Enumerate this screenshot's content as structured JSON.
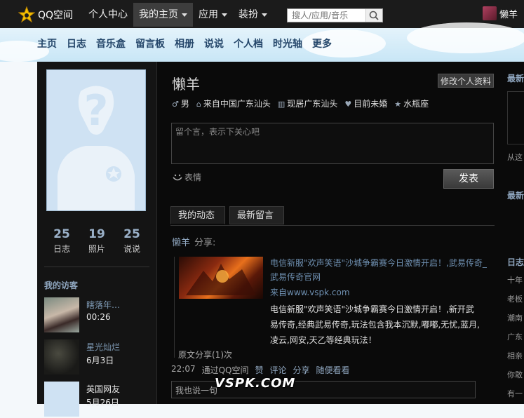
{
  "topbar": {
    "logo": "QQ空间",
    "nav": [
      {
        "label": "个人中心",
        "dropdown": false
      },
      {
        "label": "我的主页",
        "dropdown": true
      },
      {
        "label": "应用",
        "dropdown": true
      },
      {
        "label": "装扮",
        "dropdown": true
      }
    ],
    "search_placeholder": "搜人/应用/音乐",
    "username": "懒羊"
  },
  "subnav": [
    "主页",
    "日志",
    "音乐盒",
    "留言板",
    "相册",
    "说说",
    "个人档",
    "时光轴",
    "更多"
  ],
  "profile": {
    "stats": [
      {
        "value": "25",
        "label": "日志"
      },
      {
        "value": "19",
        "label": "照片"
      },
      {
        "value": "25",
        "label": "说说"
      }
    ],
    "visitors_title": "我的访客",
    "visitors": [
      {
        "name": "瞎落年…",
        "time": "00:26"
      },
      {
        "name": "星光灿烂",
        "time": "6月3日"
      },
      {
        "name": "英国网友",
        "time": "5月26日"
      }
    ]
  },
  "main": {
    "name": "懒羊",
    "edit_label": "修改个人资料",
    "info": [
      {
        "icon": "gender-icon",
        "text": "男"
      },
      {
        "icon": "home-icon",
        "text": "来自中国广东汕头"
      },
      {
        "icon": "city-icon",
        "text": "现居广东汕头"
      },
      {
        "icon": "heart-icon",
        "text": "目前未婚"
      },
      {
        "icon": "star-icon",
        "text": "水瓶座"
      }
    ],
    "message_placeholder": "留个言，表示下关心吧",
    "emoji_label": "表情",
    "send_label": "发表",
    "tabs": [
      "我的动态",
      "最新留言"
    ],
    "feed": {
      "author": "懒羊",
      "action": "分享:",
      "link_title": "电信新服\"欢声笑语\"沙城争霸赛今日激情开启！,武易传奇_武易传奇官网",
      "source": "来自www.vspk.com",
      "description": "电信新服\"欢声笑语\"沙城争霸赛今日激情开启！,新开武易传奇,经典武易传奇,玩法包含我本沉默,嘟嘟,无忧,蓝月,凌云,网安,天乙等经典玩法！",
      "original_share": "原文分享(1)次",
      "time": "22:07",
      "via": "通过QQ空间",
      "actions": [
        "赞",
        "评论",
        "分享",
        "随便看看"
      ],
      "reply_placeholder": "我也说一句"
    }
  },
  "rightcol": {
    "titles": [
      "最新",
      "最新",
      "日志"
    ],
    "text": [
      "从这",
      "十年",
      "老板",
      "潮南",
      "广东",
      "相亲",
      "你敢",
      "有一"
    ]
  },
  "watermark": "VSPK.COM",
  "colors": {
    "topbar": "#1b1b1b",
    "panel": "#0a0a0a",
    "link": "#6e8fb0",
    "accent": "#8fa6bf"
  }
}
